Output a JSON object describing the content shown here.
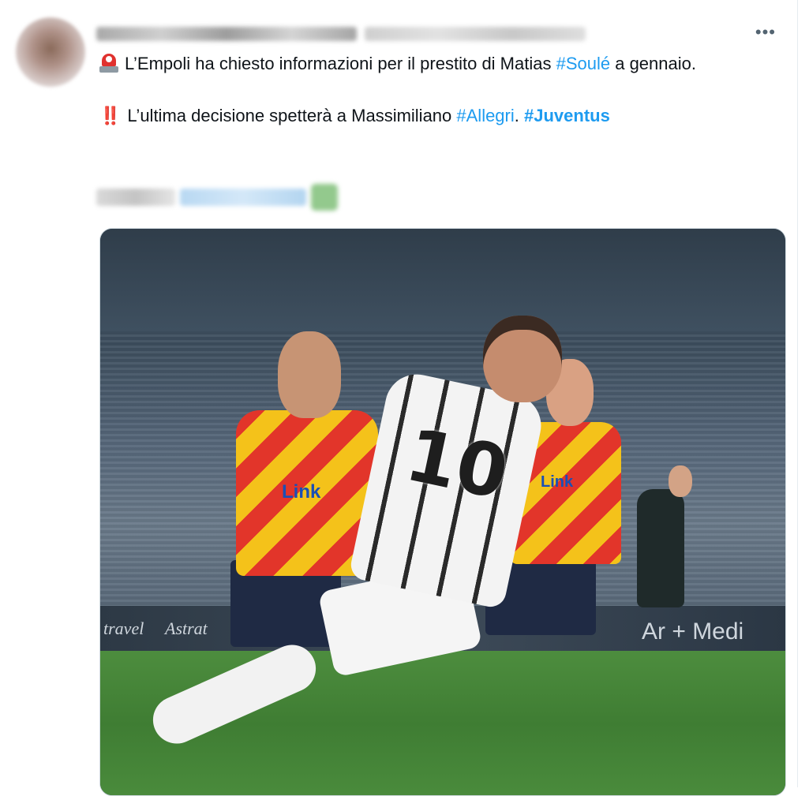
{
  "tweet": {
    "line1_pre": "L’Empoli ha chiesto informazioni per il prestito di Matias ",
    "hashtag_soule": "#Soulé",
    "line1_post": " a gennaio.",
    "line2_emoji": "‼️",
    "line2_pre": "L’ultima decisione spetterà a Massimiliano ",
    "hashtag_allegri": "#Allegri",
    "line2_mid": ".  ",
    "hashtag_juventus": "#Juventus"
  },
  "menu": {
    "more_label": "•••"
  },
  "photo": {
    "jersey_number": "10",
    "sponsor_left": "Link",
    "sponsor_right": "Link",
    "board_left_1": "travel",
    "board_left_2": "Astrat",
    "board_right": "Ar + Medi"
  },
  "colors": {
    "link": "#1d9bf0",
    "text": "#0f1419",
    "siren_red": "#e0312e"
  },
  "icons": {
    "siren": "rotating-light-icon",
    "double_exclamation": "double-exclamation-icon",
    "more": "more-horizontal-icon"
  }
}
